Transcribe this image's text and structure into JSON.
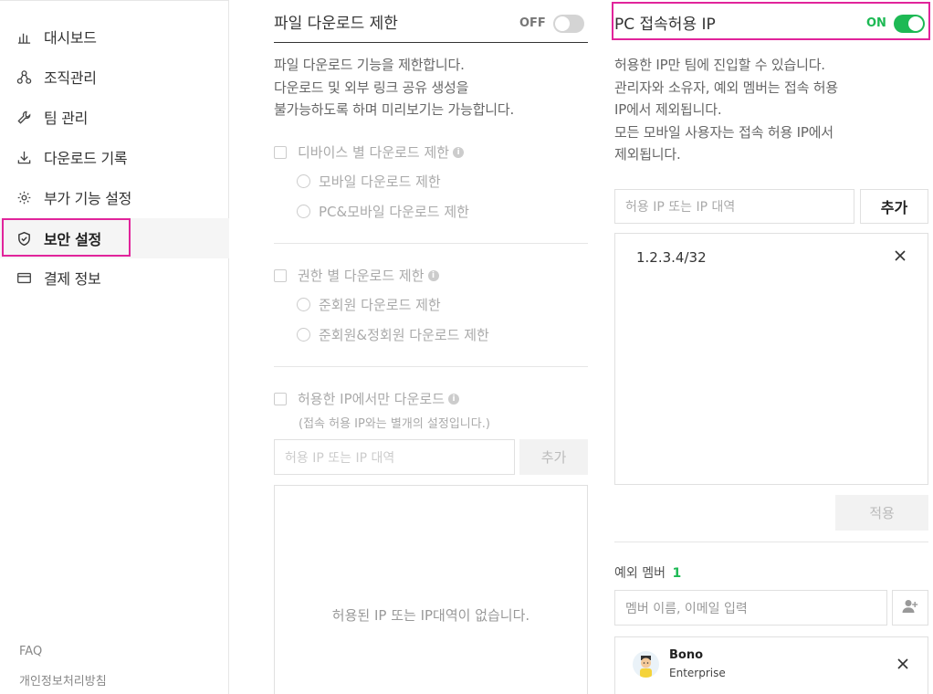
{
  "sidebar": {
    "items": [
      {
        "label": "대시보드",
        "icon": "chart-icon"
      },
      {
        "label": "조직관리",
        "icon": "org-icon"
      },
      {
        "label": "팀 관리",
        "icon": "wrench-icon"
      },
      {
        "label": "다운로드 기록",
        "icon": "download-icon"
      },
      {
        "label": "부가 기능 설정",
        "icon": "gear-icon"
      },
      {
        "label": "보안 설정",
        "icon": "shield-icon",
        "active": true
      },
      {
        "label": "결제 정보",
        "icon": "card-icon"
      }
    ],
    "footer": {
      "faq": "FAQ",
      "privacy": "개인정보처리방침"
    }
  },
  "download_limit": {
    "title": "파일 다운로드 제한",
    "toggle_label": "OFF",
    "desc_lines": [
      "파일 다운로드 기능을 제한합니다.",
      "다운로드 및 외부 링크 공유 생성을",
      "불가능하도록 하며 미리보기는 가능합니다."
    ],
    "device": {
      "label": "디바이스 별 다운로드 제한",
      "options": [
        "모바일 다운로드 제한",
        "PC&모바일 다운로드 제한"
      ]
    },
    "role": {
      "label": "권한 별 다운로드 제한",
      "options": [
        "준회원 다운로드 제한",
        "준회원&정회원 다운로드 제한"
      ]
    },
    "ip_only": {
      "label": "허용한 IP에서만 다운로드",
      "note": "(접속 허용 IP와는 별개의 설정입니다.)"
    },
    "ip_input_placeholder": "허용 IP 또는 IP 대역",
    "add_button": "추가",
    "empty_text": "허용된 IP 또는 IP대역이 없습니다."
  },
  "pc_ip": {
    "title": "PC 접속허용 IP",
    "toggle_label": "ON",
    "desc_lines": [
      "허용한 IP만 팀에 진입할 수 있습니다.",
      "관리자와 소유자, 예외 멤버는 접속 허용",
      "IP에서 제외됩니다.",
      "모든 모바일 사용자는 접속 허용 IP에서",
      "제외됩니다."
    ],
    "ip_input_placeholder": "허용 IP 또는 IP 대역",
    "add_button": "추가",
    "ip_list": [
      "1.2.3.4/32"
    ],
    "apply_button": "적용",
    "exception_label": "예외 멤버",
    "exception_count": "1",
    "member_input_placeholder": "멤버 이름, 이메일 입력",
    "members": [
      {
        "name": "Bono",
        "role": "Enterprise"
      }
    ]
  },
  "colors": {
    "accent": "#1db954",
    "highlight": "#e1249b",
    "toggle_off": "#d4d4d4"
  }
}
